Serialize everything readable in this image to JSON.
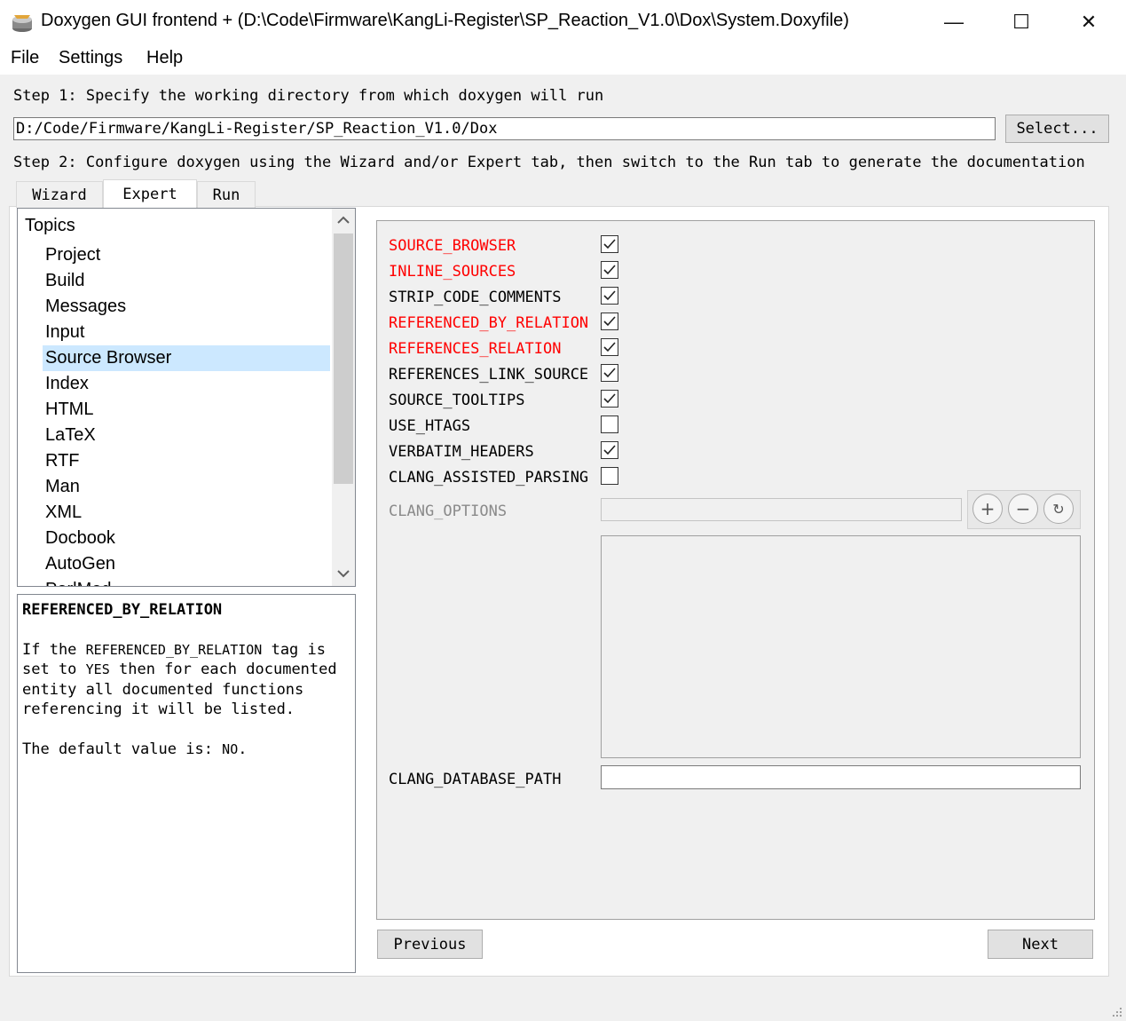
{
  "window": {
    "title": "Doxygen GUI frontend + (D:\\Code\\Firmware\\KangLi-Register\\SP_Reaction_V1.0\\Dox\\System.Doxyfile)",
    "minimize_symbol": "—",
    "maximize_symbol": "☐",
    "close_symbol": "✕"
  },
  "menu": {
    "file": "File",
    "settings": "Settings",
    "help": "Help"
  },
  "step1": {
    "label": "Step 1: Specify the working directory from which doxygen will run",
    "path": "D:/Code/Firmware/KangLi-Register/SP_Reaction_V1.0/Dox",
    "select_button": "Select..."
  },
  "step2": {
    "label": "Step 2: Configure doxygen using the Wizard and/or Expert tab, then switch to the Run tab to generate the documentation"
  },
  "tabs": [
    {
      "label": "Wizard",
      "active": false
    },
    {
      "label": "Expert",
      "active": true
    },
    {
      "label": "Run",
      "active": false
    }
  ],
  "topics": {
    "header": "Topics",
    "items": [
      "Project",
      "Build",
      "Messages",
      "Input",
      "Source Browser",
      "Index",
      "HTML",
      "LaTeX",
      "RTF",
      "Man",
      "XML",
      "Docbook",
      "AutoGen",
      "PerlMod"
    ],
    "selected": "Source Browser"
  },
  "help_panel": {
    "tag": "REFERENCED_BY_RELATION",
    "desc_prefix": "If the ",
    "desc_tag": "REFERENCED_BY_RELATION",
    "desc_mid": " tag is set to ",
    "desc_yes": "YES",
    "desc_rest": " then for each documented entity all documented functions referencing it will be listed.",
    "default_prefix": "The default value is: ",
    "default_value": "NO",
    "default_suffix": "."
  },
  "options": [
    {
      "name": "SOURCE_BROWSER",
      "checked": true,
      "modified": true
    },
    {
      "name": "INLINE_SOURCES",
      "checked": true,
      "modified": true
    },
    {
      "name": "STRIP_CODE_COMMENTS",
      "checked": true,
      "modified": false
    },
    {
      "name": "REFERENCED_BY_RELATION",
      "checked": true,
      "modified": true
    },
    {
      "name": "REFERENCES_RELATION",
      "checked": true,
      "modified": true
    },
    {
      "name": "REFERENCES_LINK_SOURCE",
      "checked": true,
      "modified": false
    },
    {
      "name": "SOURCE_TOOLTIPS",
      "checked": true,
      "modified": false
    },
    {
      "name": "USE_HTAGS",
      "checked": false,
      "modified": false
    },
    {
      "name": "VERBATIM_HEADERS",
      "checked": true,
      "modified": false
    },
    {
      "name": "CLANG_ASSISTED_PARSING",
      "checked": false,
      "modified": false
    }
  ],
  "clang_options": {
    "label": "CLANG_OPTIONS",
    "value": "",
    "add": "+",
    "remove": "−",
    "reset": "↻"
  },
  "clang_database_path": {
    "label": "CLANG_DATABASE_PATH",
    "value": ""
  },
  "nav": {
    "previous": "Previous",
    "next": "Next"
  },
  "colors": {
    "modified": "#ff0000",
    "selection": "#cce8ff",
    "disabled": "#8a8a8a"
  }
}
